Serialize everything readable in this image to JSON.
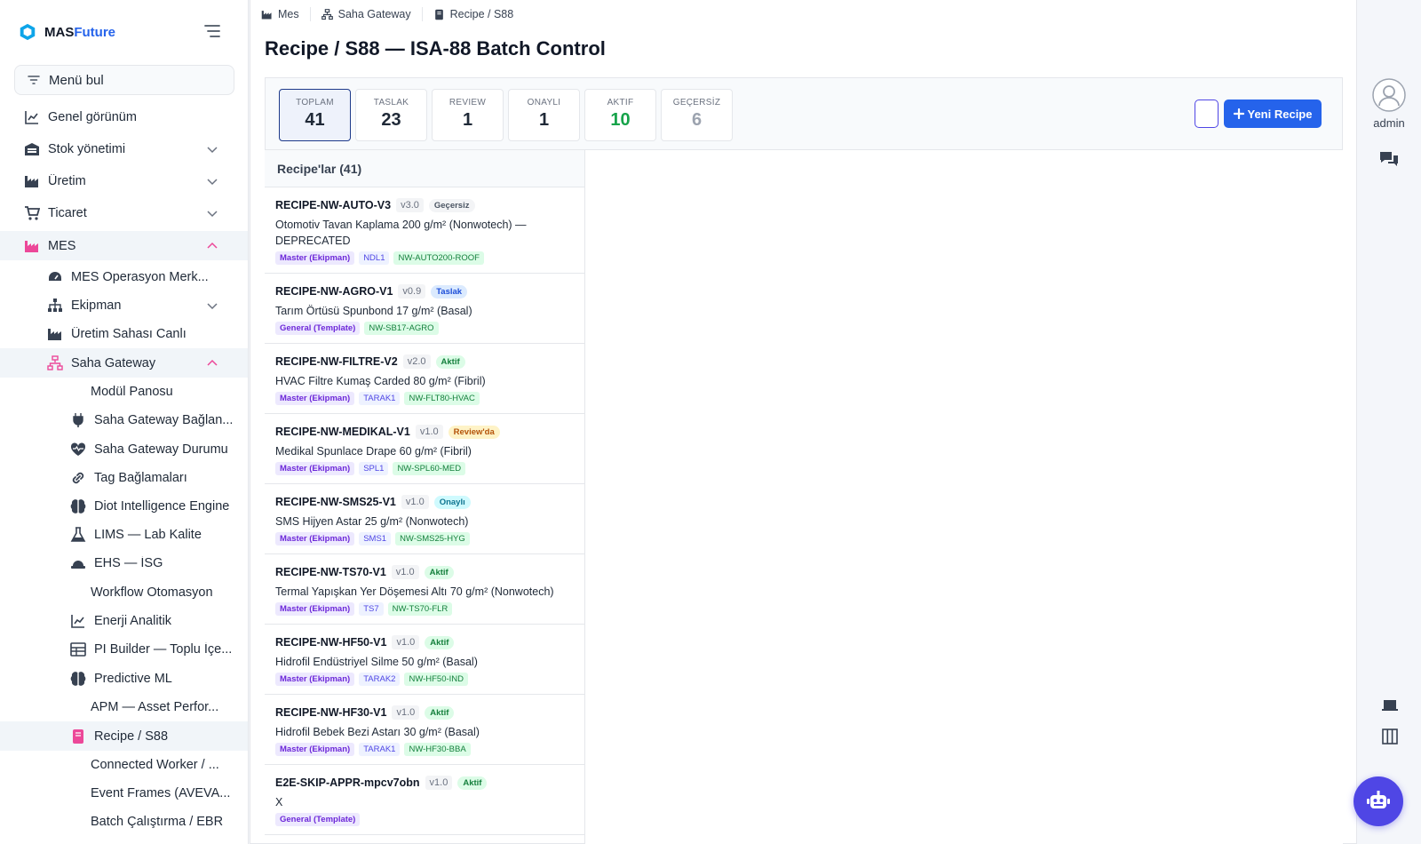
{
  "brand": {
    "prefix": "MAS",
    "suffix": "Future"
  },
  "search": {
    "placeholder": "Menü bul"
  },
  "sidebar": {
    "items": [
      {
        "label": "Genel görünüm"
      },
      {
        "label": "Stok yönetimi"
      },
      {
        "label": "Üretim"
      },
      {
        "label": "Ticaret"
      },
      {
        "label": "MES"
      },
      {
        "label": "MES Operasyon Merk..."
      },
      {
        "label": "Ekipman"
      },
      {
        "label": "Üretim Sahası Canlı"
      },
      {
        "label": "Saha Gateway"
      },
      {
        "label": "Modül Panosu"
      },
      {
        "label": "Saha Gateway Bağlan..."
      },
      {
        "label": "Saha Gateway Durumu"
      },
      {
        "label": "Tag Bağlamaları"
      },
      {
        "label": "Diot Intelligence Engine"
      },
      {
        "label": "LIMS — Lab Kalite"
      },
      {
        "label": "EHS — İSG"
      },
      {
        "label": "Workflow Otomasyon"
      },
      {
        "label": "Enerji Analitik"
      },
      {
        "label": "PI Builder — Toplu İçe..."
      },
      {
        "label": "Predictive ML"
      },
      {
        "label": "APM — Asset Perfor..."
      },
      {
        "label": "Recipe / S88"
      },
      {
        "label": "Connected Worker / ..."
      },
      {
        "label": "Event Frames (AVEVA..."
      },
      {
        "label": "Batch Çalıştırma / EBR"
      }
    ]
  },
  "breadcrumb": [
    {
      "label": "Mes"
    },
    {
      "label": "Saha Gateway"
    },
    {
      "label": "Recipe / S88"
    }
  ],
  "page": {
    "title": "Recipe / S88 — ISA-88 Batch Control"
  },
  "stats": [
    {
      "key": "TOPLAM",
      "value": "41"
    },
    {
      "key": "TASLAK",
      "value": "23"
    },
    {
      "key": "REVIEW",
      "value": "1"
    },
    {
      "key": "ONAYLI",
      "value": "1"
    },
    {
      "key": "AKTIF",
      "value": "10"
    },
    {
      "key": "GEÇERSİZ",
      "value": "6"
    }
  ],
  "actions": {
    "new_label": "Yeni Recipe",
    "new_icon": "plus-icon"
  },
  "list": {
    "title": "Recipe'lar (41)",
    "recipes": [
      {
        "code": "RECIPE-NW-AUTO-V3",
        "version": "v3.0",
        "status": "Geçersiz",
        "desc": "Otomotiv Tavan Kaplama 200 g/m² (Nonwotech) — DEPRECATED",
        "type": "Master (Ekipman)",
        "equipment": "NDL1",
        "product": "NW-AUTO200-ROOF"
      },
      {
        "code": "RECIPE-NW-AGRO-V1",
        "version": "v0.9",
        "status": "Taslak",
        "desc": "Tarım Örtüsü Spunbond 17 g/m² (Basal)",
        "type": "General (Template)",
        "equipment": "",
        "product": "NW-SB17-AGRO"
      },
      {
        "code": "RECIPE-NW-FILTRE-V2",
        "version": "v2.0",
        "status": "Aktif",
        "desc": "HVAC Filtre Kumaş Carded 80 g/m² (Fibril)",
        "type": "Master (Ekipman)",
        "equipment": "TARAK1",
        "product": "NW-FLT80-HVAC"
      },
      {
        "code": "RECIPE-NW-MEDIKAL-V1",
        "version": "v1.0",
        "status": "Review'da",
        "desc": "Medikal Spunlace Drape 60 g/m² (Fibril)",
        "type": "Master (Ekipman)",
        "equipment": "SPL1",
        "product": "NW-SPL60-MED"
      },
      {
        "code": "RECIPE-NW-SMS25-V1",
        "version": "v1.0",
        "status": "Onaylı",
        "desc": "SMS Hijyen Astar 25 g/m² (Nonwotech)",
        "type": "Master (Ekipman)",
        "equipment": "SMS1",
        "product": "NW-SMS25-HYG"
      },
      {
        "code": "RECIPE-NW-TS70-V1",
        "version": "v1.0",
        "status": "Aktif",
        "desc": "Termal Yapışkan Yer Döşemesi Altı 70 g/m² (Nonwotech)",
        "type": "Master (Ekipman)",
        "equipment": "TS7",
        "product": "NW-TS70-FLR"
      },
      {
        "code": "RECIPE-NW-HF50-V1",
        "version": "v1.0",
        "status": "Aktif",
        "desc": "Hidrofil Endüstriyel Silme 50 g/m² (Basal)",
        "type": "Master (Ekipman)",
        "equipment": "TARAK2",
        "product": "NW-HF50-IND"
      },
      {
        "code": "RECIPE-NW-HF30-V1",
        "version": "v1.0",
        "status": "Aktif",
        "desc": "Hidrofil Bebek Bezi Astarı 30 g/m² (Basal)",
        "type": "Master (Ekipman)",
        "equipment": "TARAK1",
        "product": "NW-HF30-BBA"
      },
      {
        "code": "E2E-SKIP-APPR-mpcv7obn",
        "version": "v1.0",
        "status": "Aktif",
        "desc": "X",
        "type": "General (Template)",
        "equipment": "",
        "product": ""
      }
    ]
  },
  "user": {
    "name": "admin"
  },
  "colors": {
    "accent": "#2563eb",
    "mes_pink": "#ec4899",
    "bot": "#4f46e5"
  }
}
